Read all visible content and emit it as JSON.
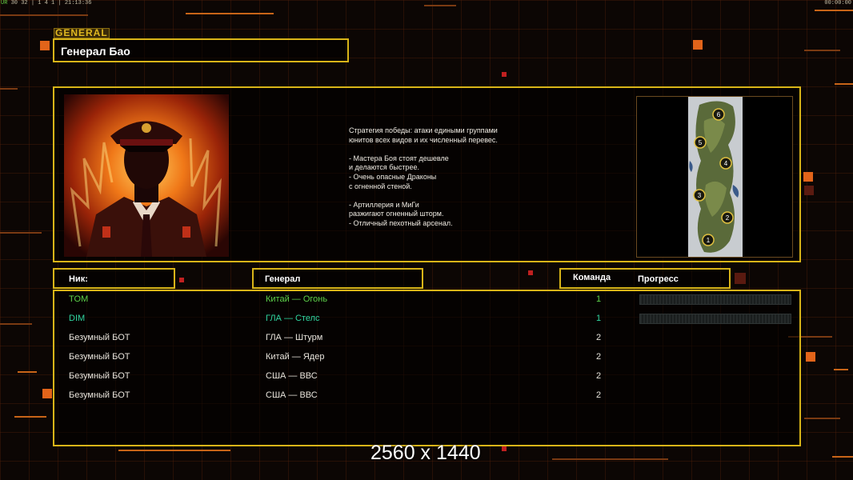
{
  "hud": {
    "stats_label": "UR",
    "stats_values": "30 32 | 1 4 1 | 21:13:36",
    "clock": "00:00:00"
  },
  "header": {
    "category_tag": "GENERAL",
    "general_name": "Генерал Бао"
  },
  "description": "Стратегия победы: атаки едиными группами\nюнитов всех видов и их численный перевес.\n\n- Мастера Боя стоят дешевле\nи делаются быстрее.\n- Очень опасные Драконы\nс огненной стеной.\n\n- Артиллерия и МиГи\nразжигают огненный шторм.\n- Отличный пехотный арсенал.",
  "minimap": {
    "start_positions": [
      "1",
      "2",
      "3",
      "4",
      "5",
      "6"
    ]
  },
  "columns": {
    "nick": "Ник:",
    "general": "Генерал",
    "team": "Команда",
    "progress": "Прогресс"
  },
  "players": [
    {
      "nick": "TOM",
      "general": "Китай — Огонь",
      "team": "1",
      "color": "#5ed24a"
    },
    {
      "nick": "DIM",
      "general": "ГЛА — Стелс",
      "team": "1",
      "color": "#30d6a0"
    },
    {
      "nick": "Безумный БОТ",
      "general": "ГЛА — Штурм",
      "team": "2",
      "color": "#e8e4dc"
    },
    {
      "nick": "Безумный БОТ",
      "general": "Китай — Ядер",
      "team": "2",
      "color": "#e8e4dc"
    },
    {
      "nick": "Безумный БОТ",
      "general": "США — ВВС",
      "team": "2",
      "color": "#e8e4dc"
    },
    {
      "nick": "Безумный БОТ",
      "general": "США — ВВС",
      "team": "2",
      "color": "#e8e4dc"
    }
  ],
  "overlay_text": "2560 x 1440",
  "colors": {
    "frame": "#d8b418",
    "accent": "#e2641a",
    "background": "#0b0604"
  }
}
